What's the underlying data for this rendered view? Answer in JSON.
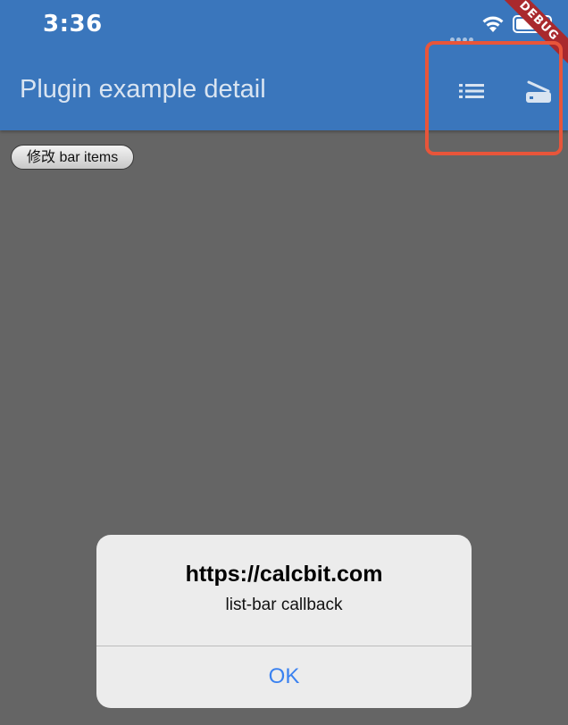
{
  "status_bar": {
    "time": "3:36"
  },
  "debug_banner": {
    "label": "DEBUG",
    "color": "#a9292d"
  },
  "app_bar": {
    "title": "Plugin example detail",
    "background": "#3a76bc",
    "actions": [
      {
        "icon": "list-icon"
      },
      {
        "icon": "tray-icon"
      }
    ],
    "highlight_color": "#e8553a"
  },
  "body": {
    "background": "#656565",
    "modify_button_label": "修改 bar items"
  },
  "alert": {
    "title": "https://calcbit.com",
    "message": "list-bar callback",
    "ok_label": "OK",
    "ok_color": "#3b82f0"
  }
}
